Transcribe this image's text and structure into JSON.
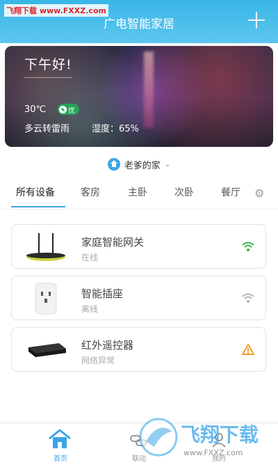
{
  "watermark": "飞翔下载 www.FXXZ.com",
  "header": {
    "title": "广电智能家居"
  },
  "weather": {
    "greeting": "下午好!",
    "temperature": "30℃",
    "air_quality": "优",
    "condition": "多云转雷雨",
    "humidity": "湿度：65%"
  },
  "home": {
    "name": "老爹的家"
  },
  "tabs": [
    "所有设备",
    "客房",
    "主卧",
    "次卧",
    "餐厅"
  ],
  "devices": [
    {
      "name": "家庭智能网关",
      "status": "在线",
      "status_icon": "wifi-icon",
      "icon_color": "#35b34a"
    },
    {
      "name": "智能插座",
      "status": "离线",
      "status_icon": "wifi-icon",
      "icon_color": "#b5b5b5"
    },
    {
      "name": "红外遥控器",
      "status": "网络异常",
      "status_icon": "warning-icon",
      "icon_color": "#f0a22e"
    }
  ],
  "nav": [
    {
      "label": "首页",
      "icon": "home-icon"
    },
    {
      "label": "联动",
      "icon": "link-icon"
    },
    {
      "label": "我的",
      "icon": "user-icon"
    }
  ],
  "logo_watermark": {
    "text": "飞翔下载",
    "url": "www.FXXZ.com"
  },
  "colors": {
    "accent": "#3aa6e8",
    "online": "#35b34a",
    "warning": "#f0a22e"
  }
}
